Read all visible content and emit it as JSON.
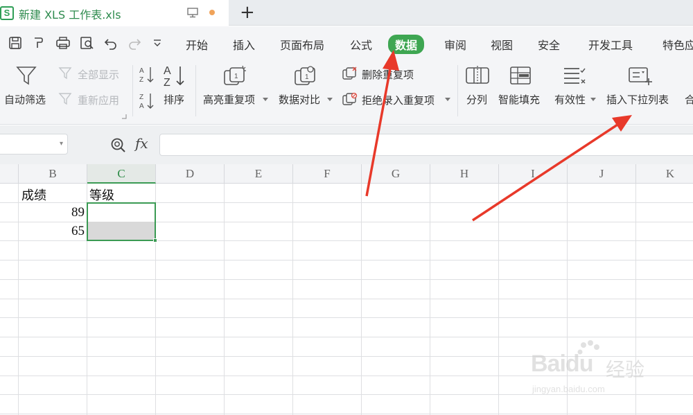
{
  "tab": {
    "logo": "S",
    "title": "新建 XLS 工作表.xls",
    "new_tab": "+"
  },
  "menu": {
    "items": [
      "开始",
      "插入",
      "页面布局",
      "公式",
      "数据",
      "审阅",
      "视图",
      "安全",
      "开发工具",
      "特色应"
    ],
    "active": "数据",
    "accent": "#3ea652"
  },
  "ribbon": {
    "auto_filter": "自动筛选",
    "show_all": "全部显示",
    "reapply": "重新应用",
    "sort": "排序",
    "highlight_dup": "高亮重复项",
    "compare": "数据对比",
    "remove_dup": "删除重复项",
    "reject_dup": "拒绝录入重复项",
    "split": "分列",
    "smart_fill": "智能填充",
    "validity": "有效性",
    "insert_dropdown": "插入下拉列表",
    "merge": "合"
  },
  "formula_bar": {
    "fx": "fx",
    "value": ""
  },
  "grid": {
    "columns": [
      "B",
      "C",
      "D",
      "E",
      "F",
      "G",
      "H",
      "I",
      "J",
      "K"
    ],
    "selected_column": "C",
    "cells": {
      "b1": "成绩",
      "c1": "等级",
      "b2": "89",
      "b3": "65"
    }
  },
  "watermark": {
    "logo": "Bai",
    "logo_du": "du",
    "jingyan": "经验",
    "url": "jingyan.baidu.com"
  },
  "annotation_color": "#e8392a"
}
